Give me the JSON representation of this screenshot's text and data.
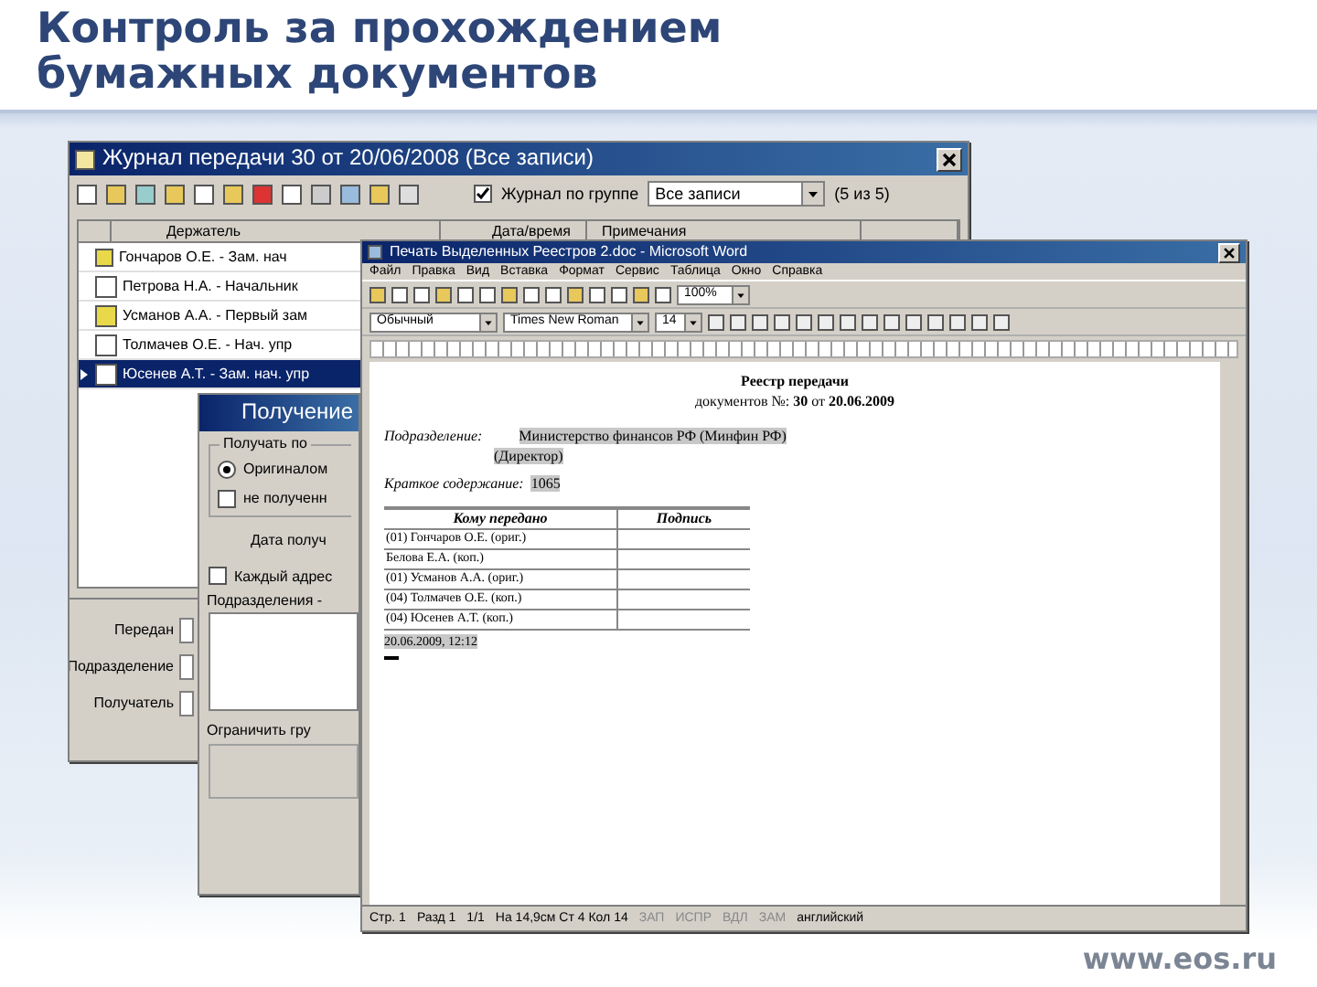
{
  "slide": {
    "title_lines": [
      "Контроль за прохождением",
      "бумажных документов"
    ],
    "footer": "www.eos.ru"
  },
  "journal": {
    "title": "Журнал передачи 30 от 20/06/2008 (Все записи)",
    "group_check": {
      "label": "Журнал по группе",
      "checked": true
    },
    "filter": {
      "value": "Все записи"
    },
    "count": "(5 из 5)",
    "columns": [
      "Держатель",
      "Дата/время",
      "Примечания"
    ],
    "rows": [
      {
        "holder": "Гончаров О.Е. - Зам. нач",
        "kind": "original",
        "selected": false
      },
      {
        "holder": "Петрова Н.А. - Начальник",
        "kind": "copy",
        "selected": false
      },
      {
        "holder": "Усманов А.А. - Первый зам",
        "kind": "mixed",
        "selected": false
      },
      {
        "holder": "Толмачев О.Е. - Нач. упр",
        "kind": "copy",
        "selected": false
      },
      {
        "holder": "Юсенев А.Т. - Зам. нач. упр",
        "kind": "copy",
        "selected": true
      }
    ],
    "form_labels": [
      "Передан",
      "Подразделение",
      "Получатель"
    ]
  },
  "receive": {
    "title": "Получение",
    "group": "Получать по",
    "radio": {
      "label": "Оригиналом",
      "selected": true
    },
    "not_received": {
      "label": "не полученн",
      "checked": false
    },
    "date_label": "Дата получ",
    "each_addressee": {
      "label": "Каждый адрес",
      "checked": false
    },
    "list_label": "Подразделения -",
    "limit_label": "Ограничить гру"
  },
  "word": {
    "title": "Печать Выделенных Реестров 2.doc - Microsoft Word",
    "menu": [
      "Файл",
      "Правка",
      "Вид",
      "Вставка",
      "Формат",
      "Сервис",
      "Таблица",
      "Окно",
      "Справка"
    ],
    "style": "Обычный",
    "font": "Times New Roman",
    "size": "14",
    "zoom": "100%",
    "doc": {
      "heading": "Реестр передачи",
      "subheading": "документов №: **30** от **20.06.2009**",
      "dept_label": "Подразделение:",
      "dept": "Министерство финансов РФ (Минфин РФ)",
      "dept_role": "(Директор)",
      "summary_label": "Краткое содержание:",
      "summary": "1065",
      "columns": [
        "Кому передано",
        "Подпись"
      ],
      "rows": [
        "(01) Гончаров О.Е. (ориг.)",
        "Белова Е.А. (коп.)",
        "(01) Усманов А.А. (ориг.)",
        "(04) Толмачев О.Е. (коп.)",
        "(04) Юсенев А.Т. (коп.)"
      ],
      "date": "20.06.2009, 12:12"
    },
    "status": [
      "Стр. 1",
      "Разд 1",
      "1/1",
      "На 14,9см Ст 4 Кол 14",
      "ЗАП",
      "ИСПР",
      "ВДЛ",
      "ЗАМ",
      "английский"
    ]
  }
}
